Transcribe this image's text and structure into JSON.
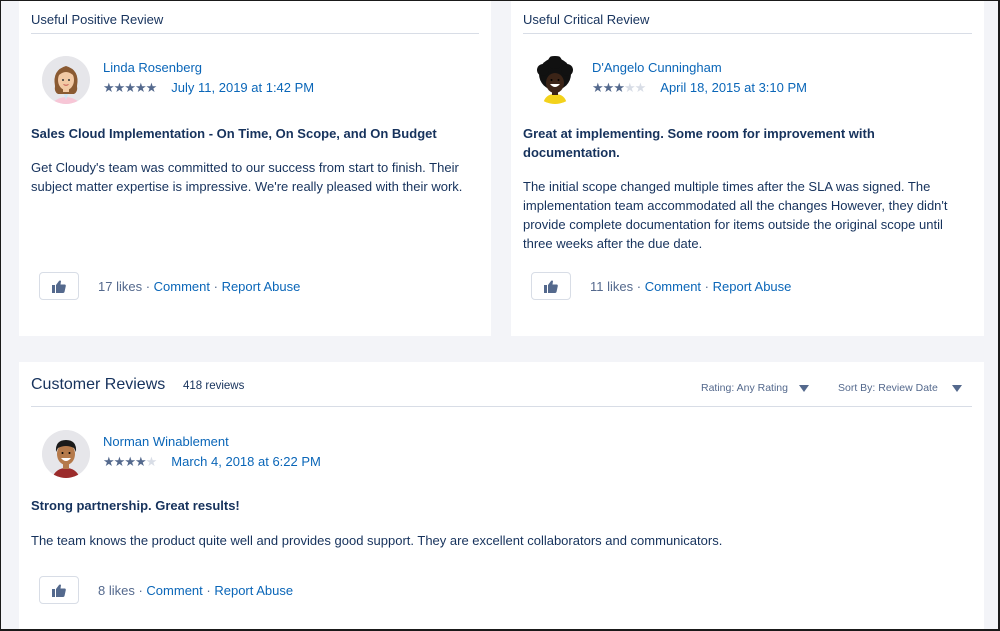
{
  "positive_card": {
    "header": "Useful Positive Review",
    "review": {
      "author": "Linda Rosenberg",
      "rating": 5,
      "rating_max": 5,
      "date": "July 11, 2019 at 1:42 PM",
      "title": "Sales Cloud Implementation - On Time, On Scope, and On Budget",
      "body": "Get Cloudy's team was committed to our success from start to finish. Their subject matter expertise is impressive. We're really pleased with their work.",
      "likes": "17 likes",
      "comment_label": "Comment",
      "report_label": "Report Abuse",
      "separator": " · "
    }
  },
  "critical_card": {
    "header": "Useful Critical Review",
    "review": {
      "author": "D'Angelo Cunningham",
      "rating": 3,
      "rating_max": 5,
      "date": "April 18, 2015 at 3:10 PM",
      "title": "Great at implementing. Some room for improvement with documentation.",
      "body": "The initial scope changed multiple times after the SLA was signed. The implementation team accommodated all the changes However, they didn't provide complete documentation for items outside the original scope until three weeks after the due date.",
      "likes": "11 likes",
      "comment_label": "Comment",
      "report_label": "Report Abuse",
      "separator": " · "
    }
  },
  "customer_reviews": {
    "title": "Customer Reviews",
    "count": "418 reviews",
    "rating_filter": "Rating: Any Rating",
    "sort_filter": "Sort By: Review Date",
    "reviews": [
      {
        "author": "Norman Winablement",
        "rating": 4,
        "rating_max": 5,
        "date": "March 4, 2018 at 6:22 PM",
        "title": "Strong partnership. Great results!",
        "body": "The team knows the product quite well and provides good support. They are excellent collaborators and communicators.",
        "likes": "8 likes",
        "comment_label": "Comment",
        "report_label": "Report Abuse",
        "separator": " · "
      }
    ]
  },
  "icons": {
    "like": "thumbs-up-icon",
    "star": "star-icon",
    "caret": "caret-down-icon"
  },
  "colors": {
    "link": "#0a66b8",
    "text": "#16325c",
    "muted": "#54698d",
    "star_on": "#54698d",
    "star_off": "#d8dde6",
    "page_bg": "#f3f4f8"
  }
}
